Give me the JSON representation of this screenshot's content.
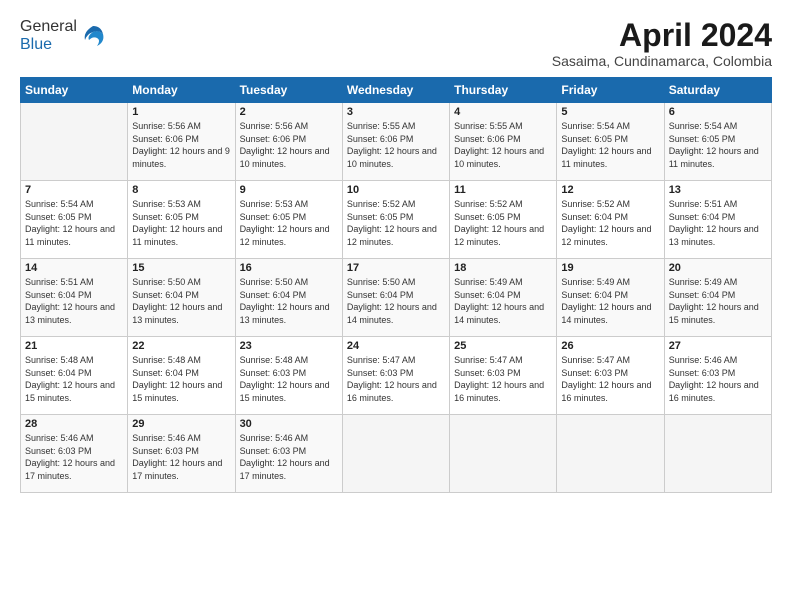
{
  "header": {
    "logo_general": "General",
    "logo_blue": "Blue",
    "month_title": "April 2024",
    "subtitle": "Sasaima, Cundinamarca, Colombia"
  },
  "weekdays": [
    "Sunday",
    "Monday",
    "Tuesday",
    "Wednesday",
    "Thursday",
    "Friday",
    "Saturday"
  ],
  "weeks": [
    [
      {
        "day": "",
        "sunrise": "",
        "sunset": "",
        "daylight": ""
      },
      {
        "day": "1",
        "sunrise": "Sunrise: 5:56 AM",
        "sunset": "Sunset: 6:06 PM",
        "daylight": "Daylight: 12 hours and 9 minutes."
      },
      {
        "day": "2",
        "sunrise": "Sunrise: 5:56 AM",
        "sunset": "Sunset: 6:06 PM",
        "daylight": "Daylight: 12 hours and 10 minutes."
      },
      {
        "day": "3",
        "sunrise": "Sunrise: 5:55 AM",
        "sunset": "Sunset: 6:06 PM",
        "daylight": "Daylight: 12 hours and 10 minutes."
      },
      {
        "day": "4",
        "sunrise": "Sunrise: 5:55 AM",
        "sunset": "Sunset: 6:06 PM",
        "daylight": "Daylight: 12 hours and 10 minutes."
      },
      {
        "day": "5",
        "sunrise": "Sunrise: 5:54 AM",
        "sunset": "Sunset: 6:05 PM",
        "daylight": "Daylight: 12 hours and 11 minutes."
      },
      {
        "day": "6",
        "sunrise": "Sunrise: 5:54 AM",
        "sunset": "Sunset: 6:05 PM",
        "daylight": "Daylight: 12 hours and 11 minutes."
      }
    ],
    [
      {
        "day": "7",
        "sunrise": "Sunrise: 5:54 AM",
        "sunset": "Sunset: 6:05 PM",
        "daylight": "Daylight: 12 hours and 11 minutes."
      },
      {
        "day": "8",
        "sunrise": "Sunrise: 5:53 AM",
        "sunset": "Sunset: 6:05 PM",
        "daylight": "Daylight: 12 hours and 11 minutes."
      },
      {
        "day": "9",
        "sunrise": "Sunrise: 5:53 AM",
        "sunset": "Sunset: 6:05 PM",
        "daylight": "Daylight: 12 hours and 12 minutes."
      },
      {
        "day": "10",
        "sunrise": "Sunrise: 5:52 AM",
        "sunset": "Sunset: 6:05 PM",
        "daylight": "Daylight: 12 hours and 12 minutes."
      },
      {
        "day": "11",
        "sunrise": "Sunrise: 5:52 AM",
        "sunset": "Sunset: 6:05 PM",
        "daylight": "Daylight: 12 hours and 12 minutes."
      },
      {
        "day": "12",
        "sunrise": "Sunrise: 5:52 AM",
        "sunset": "Sunset: 6:04 PM",
        "daylight": "Daylight: 12 hours and 12 minutes."
      },
      {
        "day": "13",
        "sunrise": "Sunrise: 5:51 AM",
        "sunset": "Sunset: 6:04 PM",
        "daylight": "Daylight: 12 hours and 13 minutes."
      }
    ],
    [
      {
        "day": "14",
        "sunrise": "Sunrise: 5:51 AM",
        "sunset": "Sunset: 6:04 PM",
        "daylight": "Daylight: 12 hours and 13 minutes."
      },
      {
        "day": "15",
        "sunrise": "Sunrise: 5:50 AM",
        "sunset": "Sunset: 6:04 PM",
        "daylight": "Daylight: 12 hours and 13 minutes."
      },
      {
        "day": "16",
        "sunrise": "Sunrise: 5:50 AM",
        "sunset": "Sunset: 6:04 PM",
        "daylight": "Daylight: 12 hours and 13 minutes."
      },
      {
        "day": "17",
        "sunrise": "Sunrise: 5:50 AM",
        "sunset": "Sunset: 6:04 PM",
        "daylight": "Daylight: 12 hours and 14 minutes."
      },
      {
        "day": "18",
        "sunrise": "Sunrise: 5:49 AM",
        "sunset": "Sunset: 6:04 PM",
        "daylight": "Daylight: 12 hours and 14 minutes."
      },
      {
        "day": "19",
        "sunrise": "Sunrise: 5:49 AM",
        "sunset": "Sunset: 6:04 PM",
        "daylight": "Daylight: 12 hours and 14 minutes."
      },
      {
        "day": "20",
        "sunrise": "Sunrise: 5:49 AM",
        "sunset": "Sunset: 6:04 PM",
        "daylight": "Daylight: 12 hours and 15 minutes."
      }
    ],
    [
      {
        "day": "21",
        "sunrise": "Sunrise: 5:48 AM",
        "sunset": "Sunset: 6:04 PM",
        "daylight": "Daylight: 12 hours and 15 minutes."
      },
      {
        "day": "22",
        "sunrise": "Sunrise: 5:48 AM",
        "sunset": "Sunset: 6:04 PM",
        "daylight": "Daylight: 12 hours and 15 minutes."
      },
      {
        "day": "23",
        "sunrise": "Sunrise: 5:48 AM",
        "sunset": "Sunset: 6:03 PM",
        "daylight": "Daylight: 12 hours and 15 minutes."
      },
      {
        "day": "24",
        "sunrise": "Sunrise: 5:47 AM",
        "sunset": "Sunset: 6:03 PM",
        "daylight": "Daylight: 12 hours and 16 minutes."
      },
      {
        "day": "25",
        "sunrise": "Sunrise: 5:47 AM",
        "sunset": "Sunset: 6:03 PM",
        "daylight": "Daylight: 12 hours and 16 minutes."
      },
      {
        "day": "26",
        "sunrise": "Sunrise: 5:47 AM",
        "sunset": "Sunset: 6:03 PM",
        "daylight": "Daylight: 12 hours and 16 minutes."
      },
      {
        "day": "27",
        "sunrise": "Sunrise: 5:46 AM",
        "sunset": "Sunset: 6:03 PM",
        "daylight": "Daylight: 12 hours and 16 minutes."
      }
    ],
    [
      {
        "day": "28",
        "sunrise": "Sunrise: 5:46 AM",
        "sunset": "Sunset: 6:03 PM",
        "daylight": "Daylight: 12 hours and 17 minutes."
      },
      {
        "day": "29",
        "sunrise": "Sunrise: 5:46 AM",
        "sunset": "Sunset: 6:03 PM",
        "daylight": "Daylight: 12 hours and 17 minutes."
      },
      {
        "day": "30",
        "sunrise": "Sunrise: 5:46 AM",
        "sunset": "Sunset: 6:03 PM",
        "daylight": "Daylight: 12 hours and 17 minutes."
      },
      {
        "day": "",
        "sunrise": "",
        "sunset": "",
        "daylight": ""
      },
      {
        "day": "",
        "sunrise": "",
        "sunset": "",
        "daylight": ""
      },
      {
        "day": "",
        "sunrise": "",
        "sunset": "",
        "daylight": ""
      },
      {
        "day": "",
        "sunrise": "",
        "sunset": "",
        "daylight": ""
      }
    ]
  ]
}
